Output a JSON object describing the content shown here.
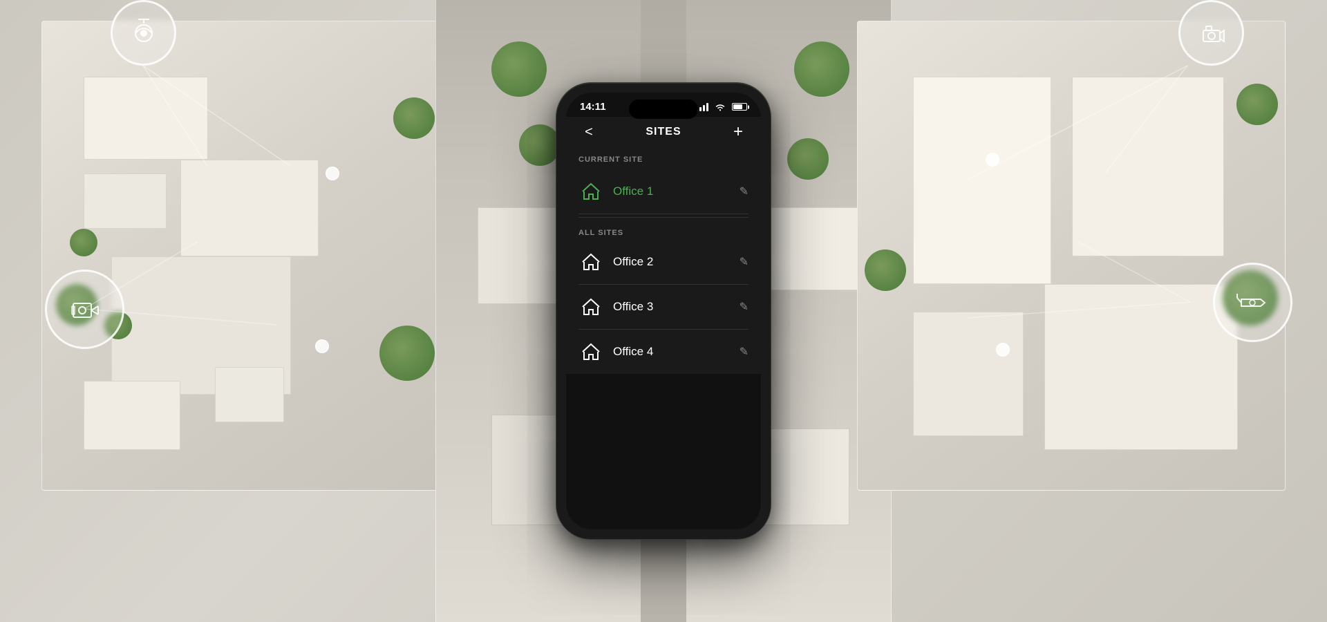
{
  "background": {
    "color": "#d0cdc5"
  },
  "phone": {
    "status_bar": {
      "time": "14:11",
      "signal": "●●●●",
      "wifi": "wifi",
      "battery": "70"
    },
    "nav": {
      "back_label": "<",
      "title": "SITES",
      "add_label": "+"
    },
    "current_site_section": {
      "label": "CURRENT SITE"
    },
    "current_site": {
      "name": "Office 1",
      "active": true
    },
    "all_sites_section": {
      "label": "ALL SITES"
    },
    "sites": [
      {
        "name": "Office 2",
        "active": false
      },
      {
        "name": "Office 3",
        "active": false
      },
      {
        "name": "Office 4",
        "active": false
      }
    ],
    "edit_icon": "✎"
  },
  "cameras": [
    {
      "position": "top-left",
      "type": "dome"
    },
    {
      "position": "top-right",
      "type": "dome"
    },
    {
      "position": "mid-left",
      "type": "box"
    },
    {
      "position": "mid-right",
      "type": "bullet"
    }
  ]
}
